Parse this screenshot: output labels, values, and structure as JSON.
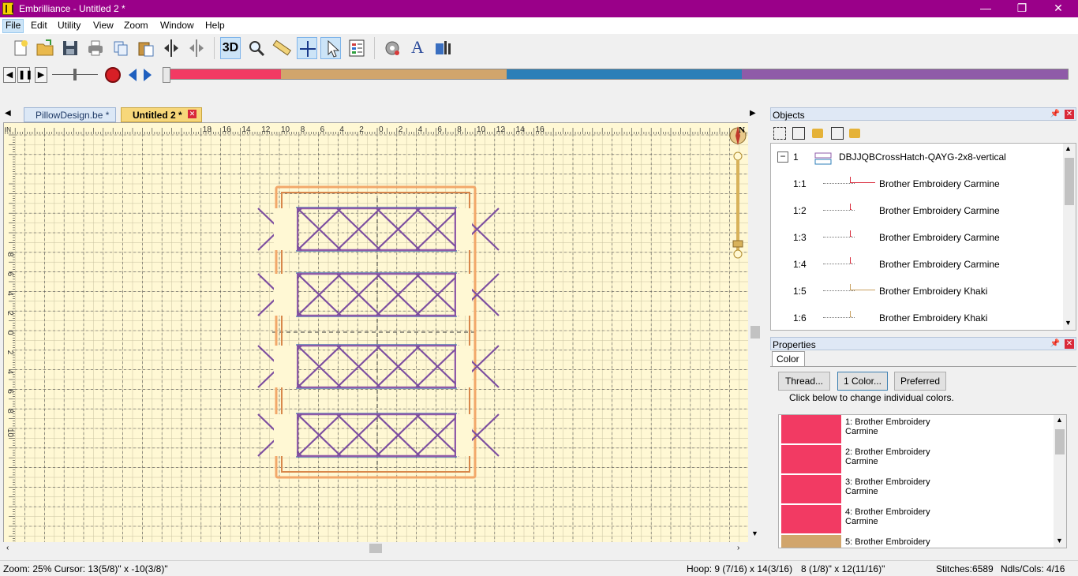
{
  "window": {
    "title": "Embrilliance -  Untitled 2 *",
    "minimize_glyph": "—",
    "restore_glyph": "❐",
    "close_glyph": "✕"
  },
  "menu": [
    "File",
    "Edit",
    "Utility",
    "View",
    "Zoom",
    "Window",
    "Help"
  ],
  "toolbar": {
    "three_d_label": "3D",
    "buttons": [
      "new-document-icon",
      "open-folder-icon",
      "save-icon",
      "print-icon",
      "copy-icon",
      "paste-icon",
      "mirror-horizontal-icon",
      "mirror-vertical-icon",
      "3d-view-icon",
      "zoom-icon",
      "measure-ruler-icon",
      "move-hoop-icon",
      "select-pointer-icon",
      "properties-icon",
      "stitch-settings-icon",
      "text-icon",
      "thread-chart-icon"
    ]
  },
  "colorbar": [
    {
      "color": "#f23a63",
      "share": 0.13
    },
    {
      "color": "#d1a56c",
      "share": 0.25
    },
    {
      "color": "#2c7fb8",
      "share": 0.26
    },
    {
      "color": "#8f5ba8",
      "share": 0.36
    }
  ],
  "tabs": [
    {
      "label": "PillowDesign.be *",
      "active": false
    },
    {
      "label": "Untitled 2 *",
      "active": true
    }
  ],
  "ruler": {
    "h_labels": [
      "18",
      "16",
      "14",
      "12",
      "10",
      "8",
      "6",
      "4",
      "2",
      "0",
      "2",
      "4",
      "6",
      "8",
      "10",
      "12",
      "14",
      "16"
    ],
    "v_labels": [
      "8",
      "6",
      "4",
      "2",
      "0",
      "2",
      "4",
      "6",
      "8",
      "10"
    ],
    "units_label": "IN"
  },
  "compass": {
    "north_label": "N"
  },
  "objects_panel": {
    "title": "Objects",
    "tools": [
      "group-icon",
      "ungroup-icon",
      "lock-icon",
      "lock-all-icon",
      "unlock-icon"
    ],
    "root": {
      "id": "1",
      "name": "DBJJQBCrossHatch-QAYG-2x8-vertical"
    },
    "items": [
      {
        "id": "1:1",
        "label": "Brother Embroidery Carmine",
        "color": "#d9293a"
      },
      {
        "id": "1:2",
        "label": "Brother Embroidery Carmine",
        "color": "#d9293a"
      },
      {
        "id": "1:3",
        "label": "Brother Embroidery Carmine",
        "color": "#d9293a"
      },
      {
        "id": "1:4",
        "label": "Brother Embroidery Carmine",
        "color": "#d9293a"
      },
      {
        "id": "1:5",
        "label": "Brother Embroidery Khaki",
        "color": "#c8a060"
      },
      {
        "id": "1:6",
        "label": "Brother Embroidery Khaki",
        "color": "#c8a060"
      }
    ]
  },
  "properties_panel": {
    "title": "Properties",
    "tab": "Color",
    "buttons": {
      "thread": "Thread...",
      "one_color": "1 Color...",
      "preferred": "Preferred"
    },
    "hint": "Click below to change individual colors.",
    "colors": [
      {
        "line1": "1: Brother Embroidery",
        "line2": "Carmine",
        "color": "#f23a63"
      },
      {
        "line1": "2: Brother Embroidery",
        "line2": "Carmine",
        "color": "#f23a63"
      },
      {
        "line1": "3: Brother Embroidery",
        "line2": "Carmine",
        "color": "#f23a63"
      },
      {
        "line1": "4: Brother Embroidery",
        "line2": "Carmine",
        "color": "#f23a63"
      },
      {
        "line1": "5: Brother Embroidery",
        "line2": "",
        "color": "#d1a56c"
      }
    ]
  },
  "status": {
    "zoom_cursor": "Zoom: 25%  Cursor: 13(5/8)\" x -10(3/8)\"",
    "hoop": "Hoop: 9 (7/16) x 14(3/16)",
    "size": "8 (1/8)\" x 12(11/16)\"",
    "stitches": "Stitches:6589",
    "ndls": "Ndls/Cols: 4/16"
  }
}
